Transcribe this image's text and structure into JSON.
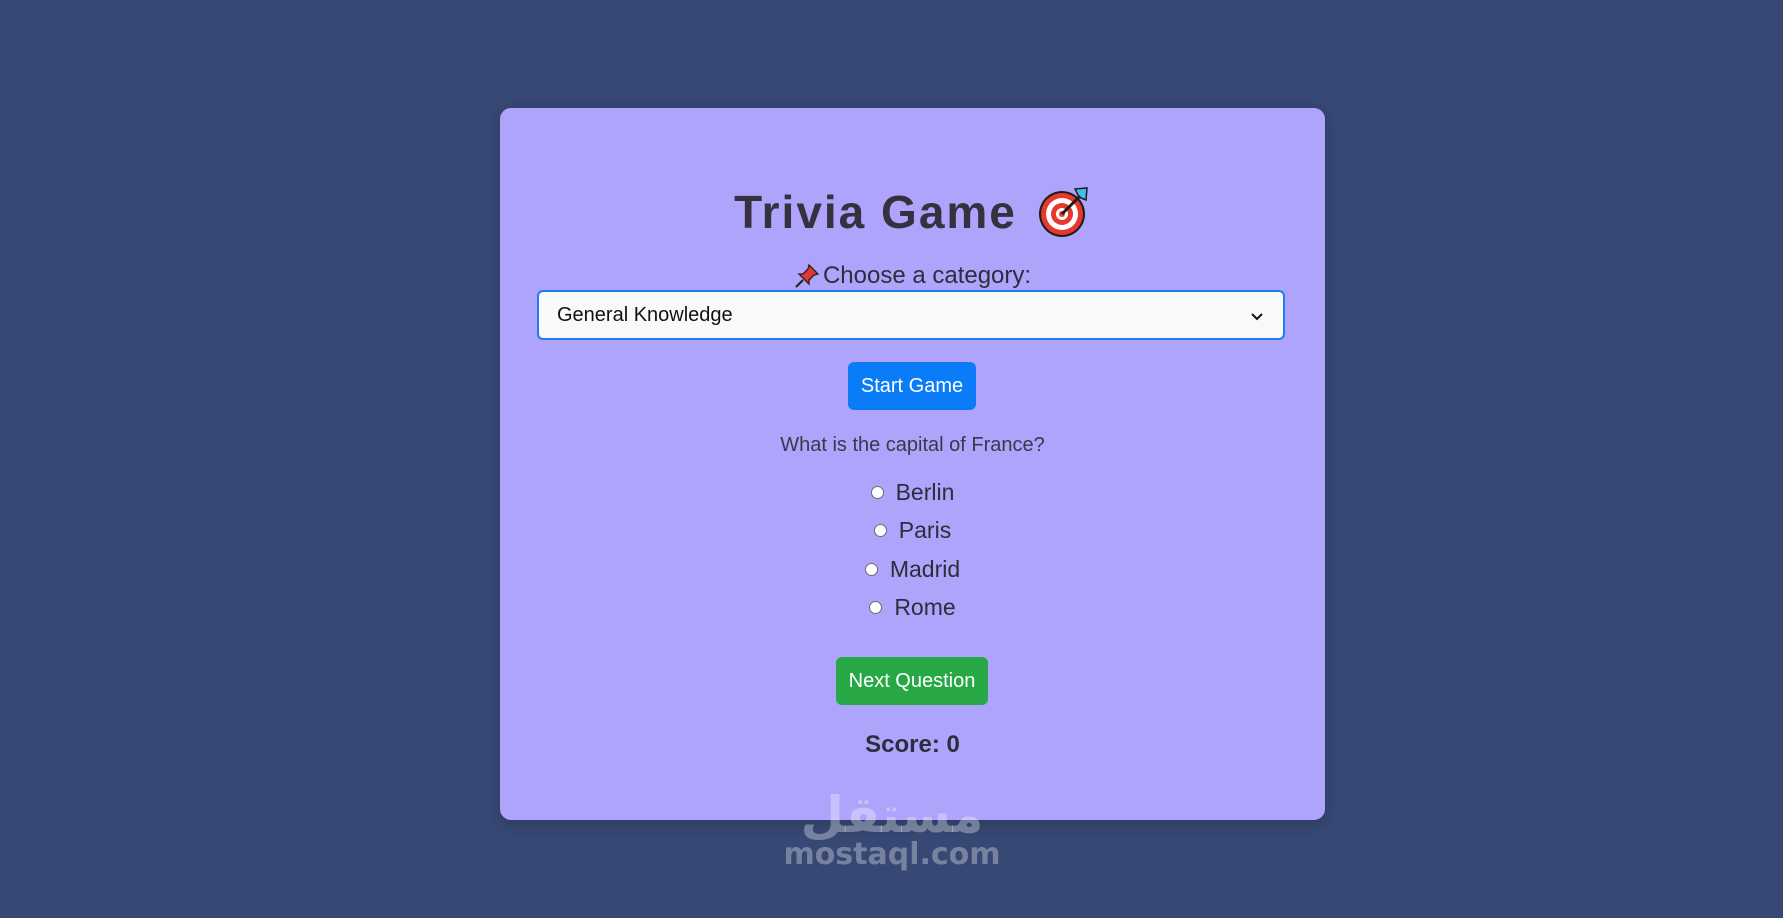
{
  "game": {
    "title": "Trivia Game",
    "title_icon": "direct-hit-target-icon",
    "category_label": "Choose a category:",
    "category_icon": "pushpin-icon",
    "category_selected": "General Knowledge",
    "start_label": "Start Game",
    "question": "What is the capital of France?",
    "options": [
      {
        "label": "Berlin"
      },
      {
        "label": "Paris"
      },
      {
        "label": "Madrid"
      },
      {
        "label": "Rome"
      }
    ],
    "next_label": "Next Question",
    "score_text": "Score: 0"
  },
  "watermark": {
    "arabic": "مستقل",
    "latin": "mostaql.com"
  },
  "colors": {
    "background": "#364873",
    "card": "#aea4fb",
    "start_button": "#0a7cf8",
    "next_button": "#28a745",
    "select_border": "#1f7cf2"
  }
}
